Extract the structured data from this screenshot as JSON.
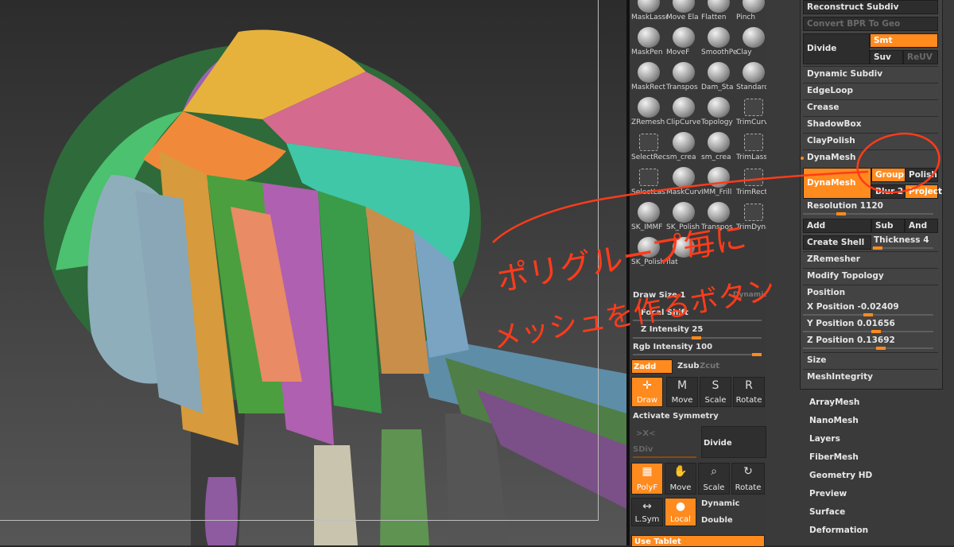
{
  "palette": {
    "brushes": [
      "MaskLasso",
      "Move Ela",
      "Flatten",
      "Pinch",
      "MaskPen",
      "MoveF",
      "SmoothPe",
      "Clay",
      "MaskRect",
      "Transpos",
      "Dam_Sta",
      "Standard",
      "ZRemesh",
      "ClipCurve",
      "Topology",
      "TrimCurv",
      "SelectRec",
      "sm_crea",
      "sm_crea",
      "TrimLass",
      "SelectLas",
      "MaskCurv",
      "IMM_Frill",
      "TrimRect",
      "SK_IMMF",
      "SK_Polish",
      "Transpos",
      "TrimDyna",
      "SK_Polish",
      "flat"
    ],
    "draw_size": "Draw Size 1",
    "dynamic": "Dynamic",
    "focal_shift": "Focal Shift",
    "z_intensity": "Z Intensity 25",
    "rgb_intensity": "Rgb Intensity 100",
    "zadd": "Zadd",
    "zsub": "Zsub",
    "zcut": "Zcut",
    "draw": "Draw",
    "move": "Move",
    "scale": "Scale",
    "rotate": "Rotate",
    "activate_symmetry": "Activate Symmetry",
    "x_axis": ">X<",
    "sdiv": "SDiv",
    "divide": "Divide",
    "polyf": "PolyF",
    "move2": "Move",
    "scale2": "Scale",
    "rotate2": "Rotate",
    "lsym": "L.Sym",
    "local": "Local",
    "dynamic2": "Dynamic",
    "double": "Double",
    "use_tablet": "Use Tablet"
  },
  "geometry": {
    "reconstruct_subdiv": "Reconstruct Subdiv",
    "convert_bpr": "Convert BPR To Geo",
    "divide": "Divide",
    "smt": "Smt",
    "suv": "Suv",
    "reuv": "ReUV",
    "dynamic_subdiv": "Dynamic Subdiv",
    "edgeloop": "EdgeLoop",
    "crease": "Crease",
    "shadowbox": "ShadowBox",
    "claypolish": "ClayPolish",
    "dynamesh_header": "DynaMesh",
    "groups": "Groups",
    "polish": "Polish",
    "dynamesh_btn": "DynaMesh",
    "blur": "Blur 2",
    "project": "Project",
    "resolution": "Resolution 1120",
    "add": "Add",
    "sub": "Sub",
    "and": "And",
    "create_shell": "Create Shell",
    "thickness": "Thickness 4",
    "zremesher": "ZRemesher",
    "modify_topology": "Modify Topology",
    "position": "Position",
    "x_position": "X Position -0.02409",
    "y_position": "Y Position 0.01656",
    "z_position": "Z Position 0.13692",
    "size": "Size",
    "meshintegrity": "MeshIntegrity"
  },
  "subtools": [
    "ArrayMesh",
    "NanoMesh",
    "Layers",
    "FiberMesh",
    "Geometry HD",
    "Preview",
    "Surface",
    "Deformation"
  ],
  "annotation": {
    "line1": "ポリグループ毎に",
    "line2": "メッシュを作るボタン"
  },
  "colors": {
    "accent": "#ff8a1e",
    "annotation": "#ff3b1a"
  }
}
